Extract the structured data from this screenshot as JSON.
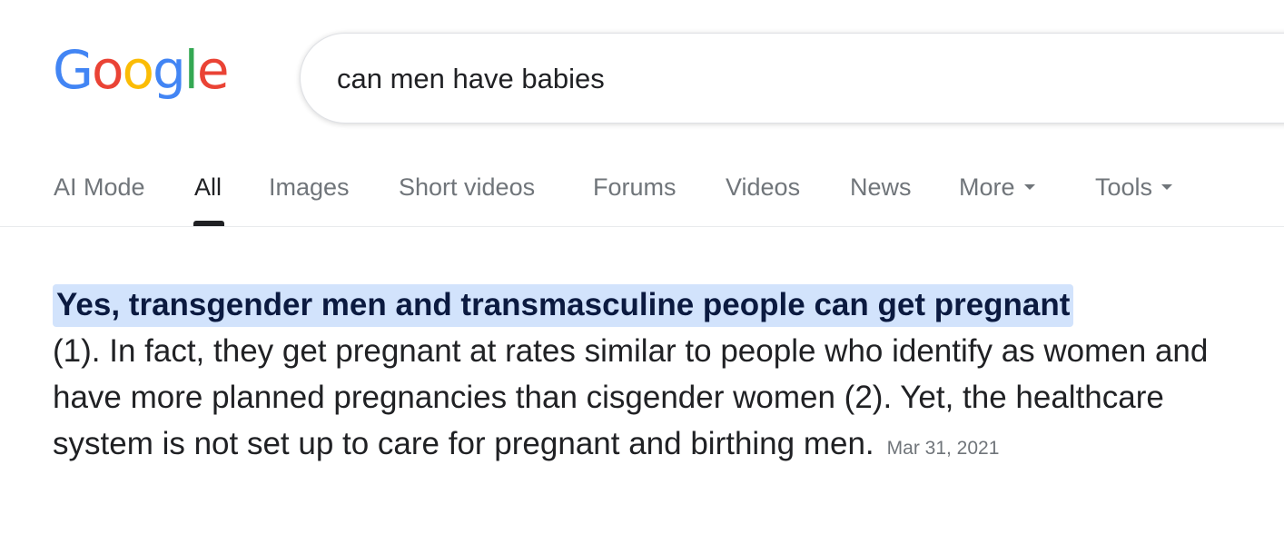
{
  "logo": {
    "letters": [
      "G",
      "o",
      "o",
      "g",
      "l",
      "e"
    ],
    "colors": [
      "#4285F4",
      "#EA4335",
      "#FBBC05",
      "#4285F4",
      "#34A853",
      "#EA4335"
    ]
  },
  "search": {
    "value": "can men have babies"
  },
  "tabs": [
    {
      "label": "AI Mode",
      "active": false
    },
    {
      "label": "All",
      "active": true
    },
    {
      "label": "Images",
      "active": false
    },
    {
      "label": "Short videos",
      "active": false
    },
    {
      "label": "Forums",
      "active": false
    },
    {
      "label": "Videos",
      "active": false
    },
    {
      "label": "News",
      "active": false
    },
    {
      "label": "More",
      "active": false,
      "dropdown": true
    },
    {
      "label": "Tools",
      "active": false,
      "dropdown": true
    }
  ],
  "snippet": {
    "highlight": "Yes, transgender men and transmasculine people can get pregnant",
    "body": " (1). In fact, they get pregnant at rates similar to people who identify as women and have more planned pregnancies than cisgender women (2). Yet, the healthcare system is not set up to care for pregnant and birthing men.",
    "date": "Mar 31, 2021"
  },
  "colors": {
    "highlight_bg": "#d2e3fc",
    "text": "#202124",
    "muted": "#70757a"
  }
}
